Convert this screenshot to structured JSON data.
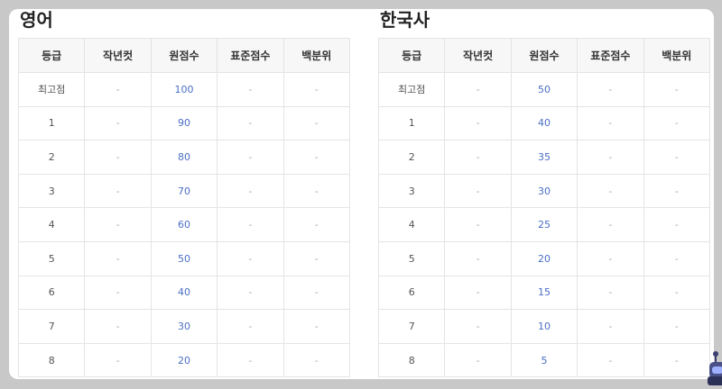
{
  "columns": [
    "등급",
    "작년컷",
    "원점수",
    "표준점수",
    "백분위"
  ],
  "english": {
    "title": "영어",
    "rows": [
      [
        "최고점",
        "-",
        "100",
        "-",
        "-"
      ],
      [
        "1",
        "-",
        "90",
        "-",
        "-"
      ],
      [
        "2",
        "-",
        "80",
        "-",
        "-"
      ],
      [
        "3",
        "-",
        "70",
        "-",
        "-"
      ],
      [
        "4",
        "-",
        "60",
        "-",
        "-"
      ],
      [
        "5",
        "-",
        "50",
        "-",
        "-"
      ],
      [
        "6",
        "-",
        "40",
        "-",
        "-"
      ],
      [
        "7",
        "-",
        "30",
        "-",
        "-"
      ],
      [
        "8",
        "-",
        "20",
        "-",
        "-"
      ]
    ]
  },
  "korean_history": {
    "title": "한국사",
    "rows": [
      [
        "최고점",
        "-",
        "50",
        "-",
        "-"
      ],
      [
        "1",
        "-",
        "40",
        "-",
        "-"
      ],
      [
        "2",
        "-",
        "35",
        "-",
        "-"
      ],
      [
        "3",
        "-",
        "30",
        "-",
        "-"
      ],
      [
        "4",
        "-",
        "25",
        "-",
        "-"
      ],
      [
        "5",
        "-",
        "20",
        "-",
        "-"
      ],
      [
        "6",
        "-",
        "15",
        "-",
        "-"
      ],
      [
        "7",
        "-",
        "10",
        "-",
        "-"
      ],
      [
        "8",
        "-",
        "5",
        "-",
        "-"
      ]
    ]
  },
  "colors": {
    "score_text": "#4a6fc4",
    "page_background": "#c8c8c8",
    "card_background": "#ffffff"
  },
  "icons": {
    "corner_widget": "chatbot-icon"
  }
}
